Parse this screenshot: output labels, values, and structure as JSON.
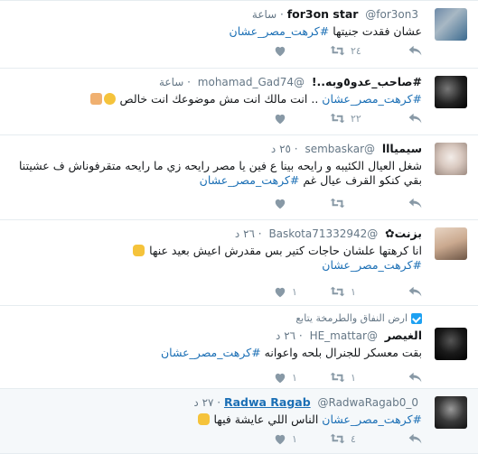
{
  "tweets": [
    {
      "fullname": "for3on star",
      "username": "@for3on3",
      "dot": "·",
      "time": "ساعة",
      "text_before": "عشان فقدت جنيتها ",
      "hashtag": "#كرهت_مصر_عشان",
      "text_after": "",
      "likes": "",
      "retweets": "٢٤",
      "avatar_colors": [
        "#6d8aa8",
        "#3b6a8f"
      ]
    },
    {
      "fullname": "#صاحب_عدو٥وبه..!",
      "username": "@mohamad_Gad74",
      "dot": "·",
      "time": "ساعة",
      "text_before": "",
      "hashtag": "#كرهت_مصر_عشان",
      "text_after": " .. انت مالك انت مش موضوعك انت خالص",
      "likes": "",
      "retweets": "٢٢",
      "avatar_colors": [
        "#222222",
        "#555555"
      ]
    },
    {
      "fullname": "سيميااا",
      "username": "@sembaskar",
      "dot": "·",
      "time": "٢٥ د",
      "text_before": "شغل العيال الكئيبه و رايحه بينا ع فين يا مصر رايحه زي ما رايحه متقرفوناش ف عشيتنا بقي كنكو القرف عيال غم ",
      "hashtag": "#كرهت_مصر_عشان",
      "text_after": "",
      "likes": "",
      "retweets": "",
      "avatar_colors": [
        "#d9c9c0",
        "#a99085"
      ]
    },
    {
      "fullname": "بزنت✿",
      "username": "@Baskota71332942",
      "dot": "·",
      "time": "٢٦ د",
      "text_before": "انا كرهتها علشان حاجات كتير بس مقدرش اعيش بعيد عنها ",
      "hashtag": "#كرهت_مصر_عشان",
      "text_after": "",
      "likes": "١",
      "retweets": "١",
      "avatar_colors": [
        "#caa98f",
        "#8a6f5a"
      ]
    },
    {
      "retweet_context": "ارض النفاق والطرمخة يتابع",
      "fullname": "الغيصر",
      "username": "@HE_mattar",
      "dot": "·",
      "time": "٢٦ د",
      "text_before": "بقت معسكر للجنرال بلحه واعوانه ",
      "hashtag": "#كرهت_مصر_عشان",
      "text_after": "",
      "likes": "١",
      "retweets": "١",
      "avatar_colors": [
        "#111111",
        "#3a3a3a"
      ]
    },
    {
      "fullname": "Radwa Ragab",
      "username": "@RadwaRagab0_0",
      "dot": "·",
      "time": "٢٧ د",
      "text_before": "",
      "hashtag": "#كرهت_مصر_عشان",
      "text_after": " الناس اللي عايشة فيها",
      "likes": "١",
      "retweets": "٤",
      "avatar_colors": [
        "#2b2b2b",
        "#6b6b6b"
      ]
    }
  ],
  "icons": {
    "reply": "reply-icon",
    "retweet": "retweet-icon",
    "like": "heart-icon"
  },
  "colors": {
    "link": "#1b6fb5",
    "muted": "#657786",
    "icon": "#8899a6"
  }
}
